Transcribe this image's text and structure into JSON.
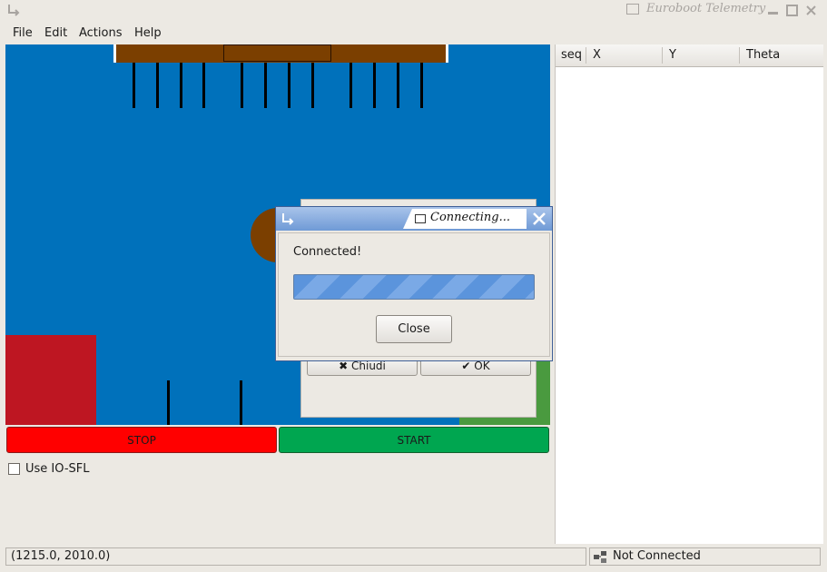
{
  "window": {
    "title": "Euroboot Telemetry"
  },
  "menu": {
    "file": "File",
    "edit": "Edit",
    "actions": "Actions",
    "help": "Help"
  },
  "field": {
    "colors": {
      "background": "#0071bb",
      "wood": "#7b3f00",
      "red_zone": "#be1622",
      "green_zone": "#4a9a3f"
    }
  },
  "background_dialog": {
    "cancel_label": "Chiudi",
    "ok_label": "OK"
  },
  "controls": {
    "stop_label": "STOP",
    "stop_color": "#ff0000",
    "start_label": "START",
    "start_color": "#00a650",
    "io_sfl_label": "Use IO-SFL",
    "io_sfl_checked": false
  },
  "table": {
    "columns": [
      "seq",
      "X",
      "Y",
      "Theta"
    ],
    "rows": []
  },
  "status": {
    "coordinates": "(1215.0, 2010.0)",
    "connection": "Not Connected"
  },
  "dialog": {
    "title": "Connecting...",
    "message": "Connected!",
    "progress": 1.0,
    "close_label": "Close"
  }
}
